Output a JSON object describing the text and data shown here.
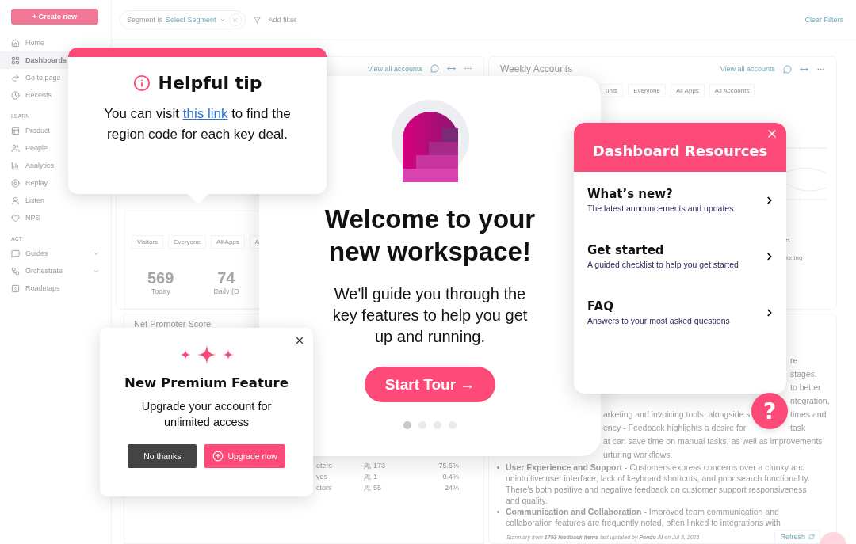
{
  "sidebar": {
    "create_button": "+ Create new",
    "groups": [
      {
        "items": [
          {
            "label": "Home",
            "kind": "link",
            "selected": false
          },
          {
            "label": "Dashboards",
            "kind": "link",
            "selected": true
          },
          {
            "label": "Go to page",
            "kind": "link",
            "selected": false
          },
          {
            "label": "Recents",
            "kind": "link",
            "selected": false
          }
        ]
      },
      {
        "heading": "LEARN",
        "items": [
          {
            "label": "Product",
            "kind": "link",
            "selected": false
          },
          {
            "label": "People",
            "kind": "link",
            "selected": false
          },
          {
            "label": "Analytics",
            "kind": "link",
            "selected": false
          },
          {
            "label": "Replay",
            "kind": "link",
            "selected": false
          },
          {
            "label": "Listen",
            "kind": "link",
            "selected": false
          },
          {
            "label": "NPS",
            "kind": "link",
            "selected": false
          }
        ]
      },
      {
        "heading": "ACT",
        "items": [
          {
            "label": "Guides",
            "kind": "group",
            "selected": false
          },
          {
            "label": "Orchestrate",
            "kind": "group",
            "selected": false
          },
          {
            "label": "Roadmaps",
            "kind": "link",
            "selected": false
          }
        ]
      }
    ]
  },
  "filter_bar": {
    "segment_label": "Segment is",
    "segment_value": "Select Segment",
    "add_filter": "Add filter",
    "clear_filters": "Clear Filters"
  },
  "visitor_card": {
    "link": "View all accounts",
    "tabs": [
      "Visitors",
      "Everyone",
      "All Apps",
      "A"
    ],
    "stats": [
      {
        "value": "569",
        "label": "Today"
      },
      {
        "value": "74",
        "label": "Daily (D"
      }
    ]
  },
  "weekly_card": {
    "title": "Weekly Accounts",
    "link": "View all accounts",
    "tabs": [
      "unts",
      "Everyone",
      "All Apps",
      "All Accounts"
    ],
    "fragments": [
      "R",
      "keting"
    ]
  },
  "nps_card": {
    "title": "Net Promoter Score",
    "rows": [
      {
        "label": "oters",
        "count": "173",
        "share": "75.5%"
      },
      {
        "label": "ves",
        "count": "1",
        "share": "0.4%"
      },
      {
        "label": "ctors",
        "count": "55",
        "share": "24%"
      }
    ]
  },
  "feedback_card": {
    "fragments": [
      {
        "right": "re"
      },
      {
        "right": "stages."
      },
      {
        "right": "to better"
      },
      {
        "right": "ntegration,"
      },
      {
        "middle": "arketing and invoicing tools, alongside sl",
        "right": "times and"
      },
      {
        "middle": "ency - Feedback highlights a desire for",
        "right": "task"
      },
      {
        "middle": "at can save time on manual tasks, as well as improvements"
      },
      {
        "middle": "urturing workflows."
      }
    ],
    "bullets": [
      "**User Experience and Support** - Customers express concerns over a clunky and unintuitive user interface, lack of keyboard shortcuts, and poor search functionality. There's both positive and negative feedback on customer support responsiveness and quality.",
      "**Communication and Collaboration** - Improved team communication and collaboration features are frequently noted, often linked to integrations with"
    ],
    "summary": "Summary from **1793 feedback items** last updated by **Pendo AI** on Jul 3, 2025",
    "refresh": "Refresh"
  },
  "tip": {
    "title": "Helpful tip",
    "body_before": "You can visit ",
    "link": "this link",
    "body_after": " to find the region code for each key deal."
  },
  "welcome": {
    "title": "Welcome to your new workspace!",
    "body": "We'll guide you through the key features to help you get up and running.",
    "button": "Start Tour →",
    "steps": [
      {
        "selected": true
      },
      {
        "selected": false
      },
      {
        "selected": false
      },
      {
        "selected": false
      }
    ]
  },
  "resources": {
    "title": "Dashboard Resources",
    "items": [
      {
        "title": "What’s new?",
        "subtitle": "The latest announcements and updates"
      },
      {
        "title": "Get started",
        "subtitle": "A guided checklist to help you get started"
      },
      {
        "title": "FAQ",
        "subtitle": "Answers to your most asked questions"
      }
    ]
  },
  "premium": {
    "title": "New Premium Feature",
    "body": "Upgrade your account for unlimited access",
    "buttons": [
      {
        "label": "No thanks",
        "kind": "secondary"
      },
      {
        "label": "Upgrade now",
        "kind": "primary"
      }
    ]
  },
  "help_button": {
    "label": "?"
  }
}
